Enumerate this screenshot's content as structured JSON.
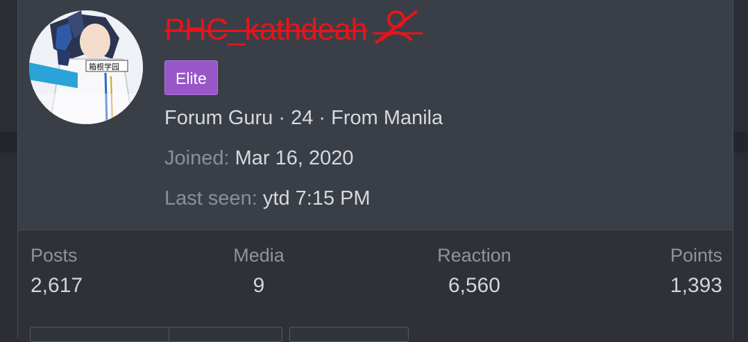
{
  "profile": {
    "username": "PHC_kathdeah",
    "username_icon": "user-slash-icon",
    "badge": "Elite",
    "info_line": "Forum Guru · 24 · From Manila",
    "joined_label": "Joined:",
    "joined_value": "Mar 16, 2020",
    "last_seen_label": "Last seen:",
    "last_seen_value": "ytd 7:15 PM",
    "avatar": "avatar-image"
  },
  "stats": [
    {
      "label": "Posts",
      "value": "2,617"
    },
    {
      "label": "Media",
      "value": "9"
    },
    {
      "label": "Reaction",
      "value": "6,560"
    },
    {
      "label": "Points",
      "value": "1,393"
    }
  ],
  "colors": {
    "username": "#e8141a",
    "badge": "#9856c9",
    "card": "#3a3f47",
    "stats_panel": "#2e3138"
  }
}
